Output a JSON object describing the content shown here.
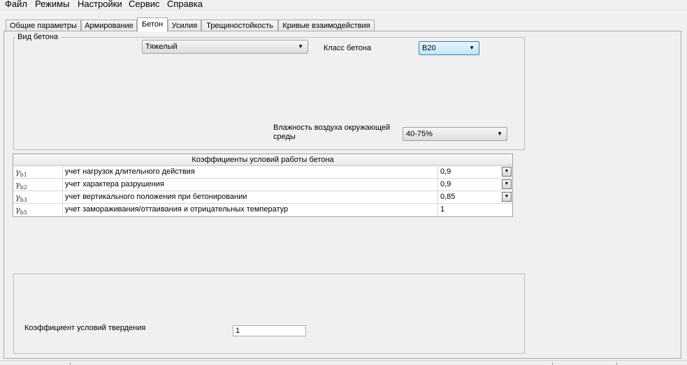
{
  "menu": [
    "Файл",
    "Режимы",
    "Настройки",
    "Сервис",
    "Справка"
  ],
  "tabs": [
    {
      "label": "Общие параметры",
      "active": false
    },
    {
      "label": "Армирование",
      "active": false
    },
    {
      "label": "Бетон",
      "active": true
    },
    {
      "label": "Усилия",
      "active": false
    },
    {
      "label": "Трещиностойкость",
      "active": false
    },
    {
      "label": "Кривые взаимодействия",
      "active": false
    }
  ],
  "concrete": {
    "group_title": "Вид бетона",
    "type_value": "Тяжелый",
    "class_label": "Класс бетона",
    "class_value": "B20",
    "humidity_label_line1": "Влажность воздуха окружающей",
    "humidity_label_line2": "среды",
    "humidity_value": "40-75%"
  },
  "coefficients": {
    "header": "Коэффициенты условий работы бетона",
    "rows": [
      {
        "symbol": "γ",
        "sub": "b1",
        "description": "учет нагрузок длительного действия",
        "value": "0,9",
        "has_dropdown": true
      },
      {
        "symbol": "γ",
        "sub": "b2",
        "description": "учет характера разрушения",
        "value": "0,9",
        "has_dropdown": true
      },
      {
        "symbol": "γ",
        "sub": "b3",
        "description": "учет вертикального положения при бетонировании",
        "value": "0,85",
        "has_dropdown": true
      },
      {
        "symbol": "γ",
        "sub": "b5",
        "description": "учет замораживания/оттаивания и отрицательных температур",
        "value": "1",
        "has_dropdown": false
      }
    ]
  },
  "hardening": {
    "label": "Коэффициент условий твердения",
    "value": "1"
  },
  "colors": {
    "focus_border": "#3c7fb1",
    "panel_bg": "#f0f0f0"
  }
}
